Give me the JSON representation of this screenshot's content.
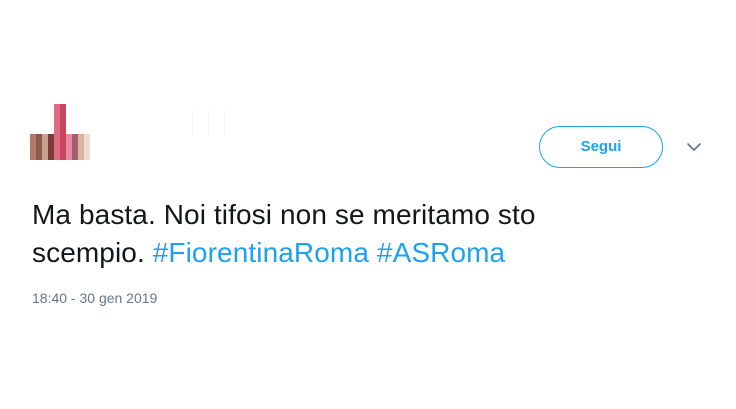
{
  "tweet": {
    "follow_label": "Segui",
    "caret_icon": "chevron-down-icon",
    "text_before": "Ma basta. Noi tifosi non se meritamo sto scempio.",
    "hashtags": [
      "#FiorentinaRoma",
      "#ASRoma"
    ],
    "timestamp": "18:40 - 30 gen 2019"
  },
  "colors": {
    "accent": "#1da1f2",
    "text": "#14171a",
    "muted": "#657786"
  }
}
